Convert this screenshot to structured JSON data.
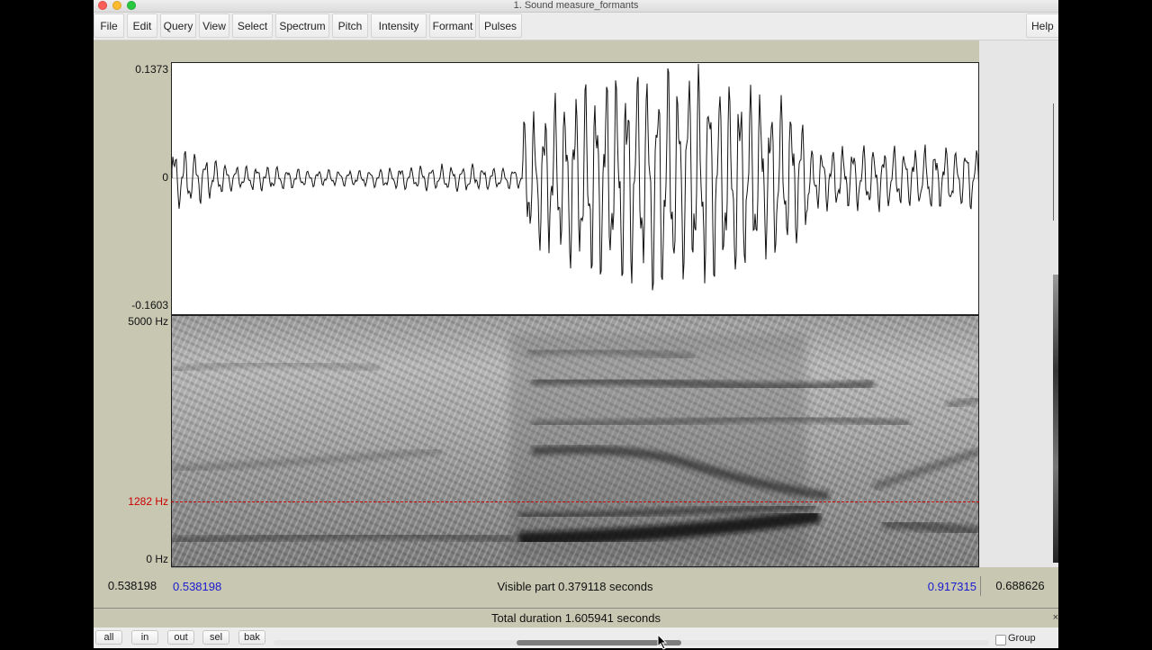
{
  "window": {
    "title": "1. Sound measure_formants"
  },
  "menu": {
    "items": [
      "File",
      "Edit",
      "Query",
      "View",
      "Select",
      "Spectrum",
      "Pitch",
      "Intensity",
      "Formant",
      "Pulses"
    ],
    "help": "Help"
  },
  "waveform": {
    "y_max": "0.1373",
    "y_zero": "0",
    "y_min": "-0.1603"
  },
  "spectrogram": {
    "f_max": "5000 Hz",
    "f_cursor": "1282 Hz",
    "f_min": "0 Hz",
    "cursor_color": "#cc0000"
  },
  "timebar": {
    "left_time": "0.538198",
    "visible_start": "0.538198",
    "visible_label": "Visible part 0.379118 seconds",
    "visible_end": "0.917315",
    "right_time": "0.688626",
    "total_label": "Total duration 1.605941 seconds",
    "time_color": "#1a1ad0"
  },
  "controls": {
    "buttons": [
      "all",
      "in",
      "out",
      "sel",
      "bak"
    ],
    "group_label": "Group",
    "group_checked": false,
    "scroll_position": 0.34,
    "scroll_size": 0.23
  }
}
